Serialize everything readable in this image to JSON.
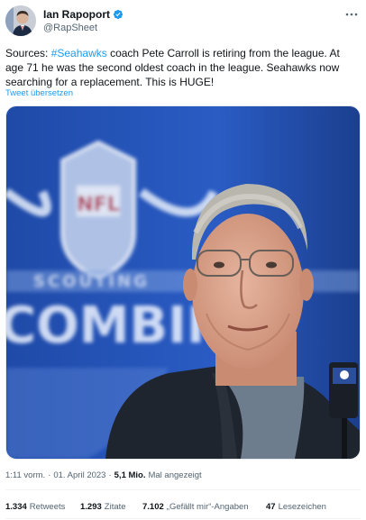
{
  "author": {
    "display_name": "Ian Rapoport",
    "handle": "@RapSheet",
    "verified_color": "#1d9bf0"
  },
  "tweet": {
    "text_part1": "Sources: ",
    "hashtag": "#Seahawks",
    "text_part2": " coach Pete Carroll is retiring from the league. At age 71 he was the second oldest coach in the league. Seahawks now searching for a replacement. This is HUGE!",
    "translate_link": "Tweet übersetzen"
  },
  "photo": {
    "background_text": "COMBINE",
    "scouting_text": "SCOUTING",
    "shield_text": "NFL"
  },
  "meta": {
    "time": "1:11 vorm.",
    "separator": "·",
    "date": "01. April 2023",
    "views_separator": "·",
    "views": "5,1 Mio.",
    "views_label": "Mal angezeigt"
  },
  "stats": {
    "retweets_count": "1.334",
    "retweets_label": "Retweets",
    "quotes_count": "1.293",
    "quotes_label": "Zitate",
    "likes_count": "7.102",
    "likes_label": "„Gefällt mir“-Angaben",
    "bookmarks_count": "47",
    "bookmarks_label": "Lesezeichen"
  },
  "colors": {
    "link": "#1d9bf0",
    "secondary_text": "#536471",
    "primary_text": "#0f1419"
  }
}
